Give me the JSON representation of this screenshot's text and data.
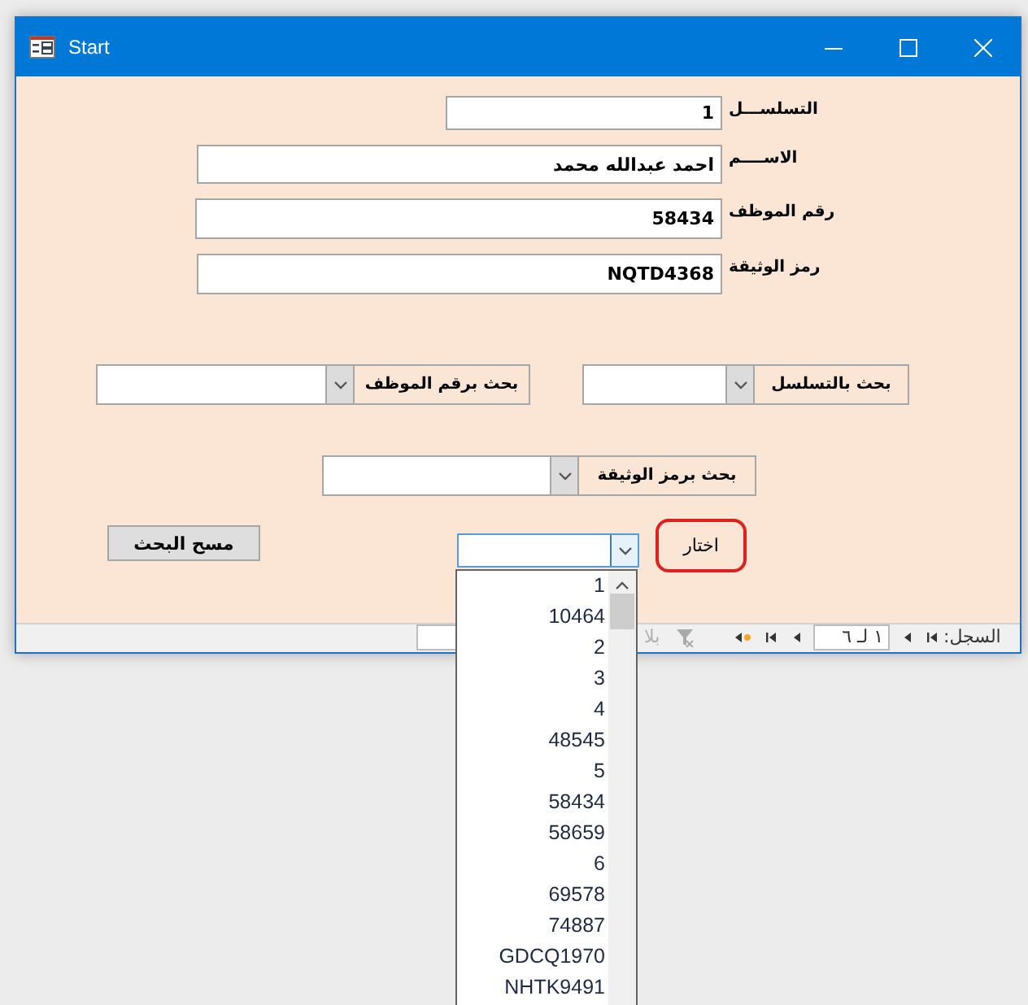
{
  "window": {
    "title": "Start"
  },
  "fields": [
    {
      "label": "التسلســـل",
      "value": "1"
    },
    {
      "label": "الاســــم",
      "value": "احمد عبدالله محمد"
    },
    {
      "label": "رقم الموظف",
      "value": "58434"
    },
    {
      "label": "رمز الوثيقة",
      "value": "NQTD4368"
    }
  ],
  "search_combos": [
    {
      "label": "بحث بالتسلسل"
    },
    {
      "label": "بحث برقم الموظف"
    },
    {
      "label": "بحث برمز الوثيقة"
    }
  ],
  "clear_button": "مسح البحث",
  "choose_combo": {
    "label": "اختار",
    "expanded": true,
    "options": [
      "1",
      "10464",
      "2",
      "3",
      "4",
      "48545",
      "5",
      "58434",
      "58659",
      "6",
      "69578",
      "74887",
      "GDCQ1970",
      "NHTK9491"
    ]
  },
  "navigation": {
    "record_label": "السجل:",
    "position": "١ لـ ٦",
    "filter": "بلا"
  }
}
